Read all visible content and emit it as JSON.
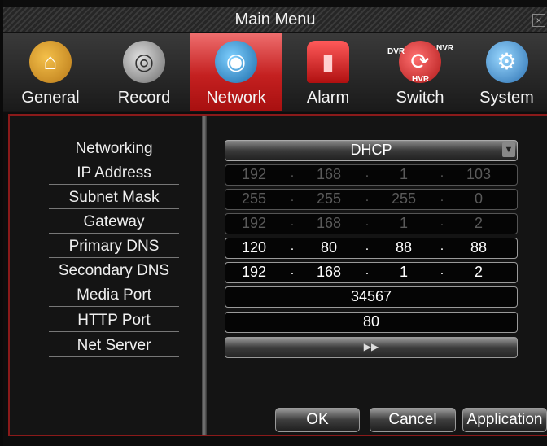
{
  "window": {
    "title": "Main Menu",
    "close_glyph": "×"
  },
  "tabs": [
    {
      "label": "General",
      "icon": "house-icon",
      "glyph": "⌂",
      "active": false
    },
    {
      "label": "Record",
      "icon": "film-reel-icon",
      "glyph": "◎",
      "active": false
    },
    {
      "label": "Network",
      "icon": "network-globe-icon",
      "glyph": "◉",
      "active": true
    },
    {
      "label": "Alarm",
      "icon": "alarm-siren-icon",
      "glyph": "▮",
      "active": false
    },
    {
      "label": "Switch",
      "icon": "dvr-nvr-switch-icon",
      "glyph": "⟳",
      "active": false,
      "sub_labels": [
        "DVR",
        "NVR",
        "HVR"
      ]
    },
    {
      "label": "System",
      "icon": "gear-icon",
      "glyph": "⚙",
      "active": false
    }
  ],
  "form": {
    "labels": {
      "networking": "Networking",
      "ip_address": "IP Address",
      "subnet_mask": "Subnet Mask",
      "gateway": "Gateway",
      "primary_dns": "Primary DNS",
      "secondary_dns": "Secondary DNS",
      "media_port": "Media Port",
      "http_port": "HTTP Port",
      "net_server": "Net Server"
    },
    "networking_value": "DHCP",
    "ip_address": [
      "192",
      "168",
      "1",
      "103"
    ],
    "subnet_mask": [
      "255",
      "255",
      "255",
      "0"
    ],
    "gateway": [
      "192",
      "168",
      "1",
      "2"
    ],
    "primary_dns": [
      "120",
      "80",
      "88",
      "88"
    ],
    "secondary_dns": [
      "192",
      "168",
      "1",
      "2"
    ],
    "ip_separator": ".",
    "media_port": "34567",
    "http_port": "80",
    "net_server_glyph": "▶▶"
  },
  "buttons": {
    "ok": "OK",
    "cancel": "Cancel",
    "apply": "Application"
  },
  "colors": {
    "active_tab": "#c42020",
    "panel_border": "#8a1a1a"
  }
}
